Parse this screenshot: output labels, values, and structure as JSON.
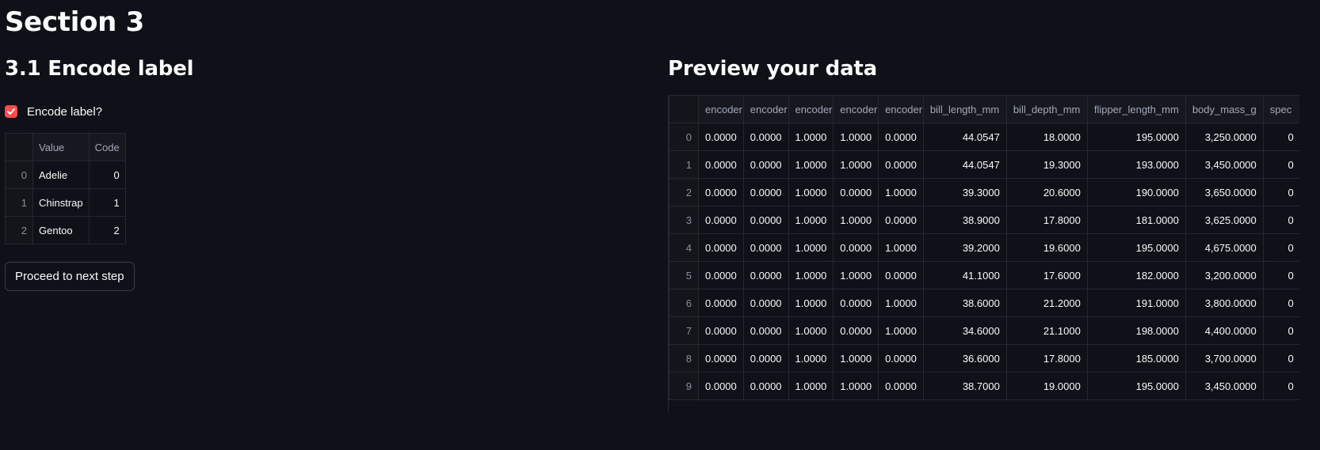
{
  "page_title": "Section 3",
  "left": {
    "heading": "3.1 Encode label",
    "checkbox_label": "Encode label?",
    "checkbox_checked": true,
    "label_table": {
      "headers": [
        "",
        "Value",
        "Code"
      ],
      "rows": [
        [
          "0",
          "Adelie",
          "0"
        ],
        [
          "1",
          "Chinstrap",
          "1"
        ],
        [
          "2",
          "Gentoo",
          "2"
        ]
      ]
    },
    "proceed_button": "Proceed to next step"
  },
  "right": {
    "heading": "Preview your data",
    "data_table": {
      "headers": [
        "",
        "encoder",
        "encoder",
        "encoder",
        "encoder",
        "encoder",
        "bill_length_mm",
        "bill_depth_mm",
        "flipper_length_mm",
        "body_mass_g",
        "spec"
      ],
      "rows": [
        [
          "0",
          "0.0000",
          "0.0000",
          "1.0000",
          "1.0000",
          "0.0000",
          "44.0547",
          "18.0000",
          "195.0000",
          "3,250.0000",
          "0"
        ],
        [
          "1",
          "0.0000",
          "0.0000",
          "1.0000",
          "1.0000",
          "0.0000",
          "44.0547",
          "19.3000",
          "193.0000",
          "3,450.0000",
          "0"
        ],
        [
          "2",
          "0.0000",
          "0.0000",
          "1.0000",
          "0.0000",
          "1.0000",
          "39.3000",
          "20.6000",
          "190.0000",
          "3,650.0000",
          "0"
        ],
        [
          "3",
          "0.0000",
          "0.0000",
          "1.0000",
          "1.0000",
          "0.0000",
          "38.9000",
          "17.8000",
          "181.0000",
          "3,625.0000",
          "0"
        ],
        [
          "4",
          "0.0000",
          "0.0000",
          "1.0000",
          "0.0000",
          "1.0000",
          "39.2000",
          "19.6000",
          "195.0000",
          "4,675.0000",
          "0"
        ],
        [
          "5",
          "0.0000",
          "0.0000",
          "1.0000",
          "1.0000",
          "0.0000",
          "41.1000",
          "17.6000",
          "182.0000",
          "3,200.0000",
          "0"
        ],
        [
          "6",
          "0.0000",
          "0.0000",
          "1.0000",
          "0.0000",
          "1.0000",
          "38.6000",
          "21.2000",
          "191.0000",
          "3,800.0000",
          "0"
        ],
        [
          "7",
          "0.0000",
          "0.0000",
          "1.0000",
          "0.0000",
          "1.0000",
          "34.6000",
          "21.1000",
          "198.0000",
          "4,400.0000",
          "0"
        ],
        [
          "8",
          "0.0000",
          "0.0000",
          "1.0000",
          "1.0000",
          "0.0000",
          "36.6000",
          "17.8000",
          "185.0000",
          "3,700.0000",
          "0"
        ],
        [
          "9",
          "0.0000",
          "0.0000",
          "1.0000",
          "1.0000",
          "0.0000",
          "38.7000",
          "19.0000",
          "195.0000",
          "3,450.0000",
          "0"
        ]
      ]
    }
  },
  "colors": {
    "background": "#0e1117",
    "accent": "#ff4b4b",
    "text": "#fafafa",
    "muted": "#a3a8b8"
  },
  "icons": {
    "checkbox": "check-icon"
  }
}
